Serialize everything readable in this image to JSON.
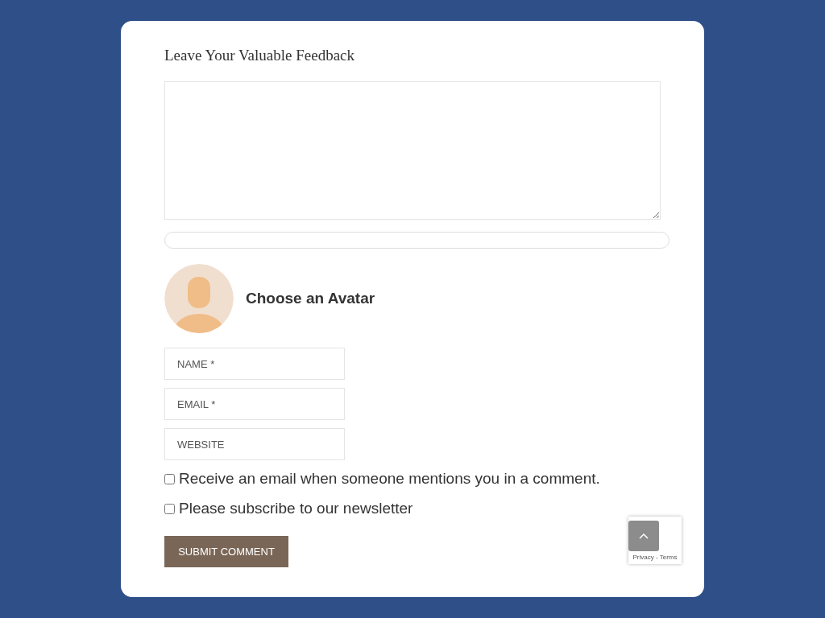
{
  "title": "Leave Your Valuable Feedback",
  "avatar": {
    "label": "Choose an Avatar"
  },
  "fields": [
    {
      "placeholder": "NAME *"
    },
    {
      "placeholder": "EMAIL *"
    },
    {
      "placeholder": "WEBSITE"
    }
  ],
  "options": [
    {
      "label": "Receive an email when someone mentions you in a comment.",
      "checked": false
    },
    {
      "label": "Please subscribe to our newsletter",
      "checked": false
    }
  ],
  "submit": "SUBMIT COMMENT",
  "recaptcha": {
    "links": "Privacy - Terms"
  }
}
